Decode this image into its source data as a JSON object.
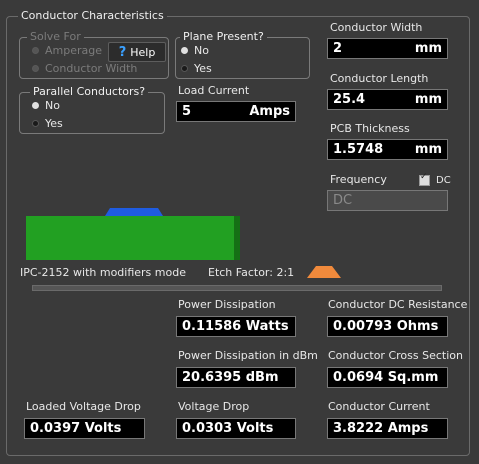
{
  "panel": {
    "title": "Conductor Characteristics"
  },
  "solve_for": {
    "title": "Solve For",
    "options": [
      "Amperage",
      "Conductor Width"
    ],
    "help_label": "Help"
  },
  "plane_present": {
    "title": "Plane Present?",
    "options": [
      "No",
      "Yes"
    ]
  },
  "parallel": {
    "title": "Parallel Conductors?",
    "options": [
      "No",
      "Yes"
    ]
  },
  "load_current": {
    "label": "Load Current",
    "value": "5",
    "unit": "Amps"
  },
  "conductor_width": {
    "label": "Conductor Width",
    "value": "2",
    "unit": "mm"
  },
  "conductor_length": {
    "label": "Conductor Length",
    "value": "25.4",
    "unit": "mm"
  },
  "pcb_thickness": {
    "label": "PCB Thickness",
    "value": "1.5748",
    "unit": "mm"
  },
  "frequency": {
    "label": "Frequency",
    "dc_label": "DC",
    "value": "DC"
  },
  "mode_text": "IPC-2152 with modifiers mode",
  "etch_factor": "Etch Factor: 2:1",
  "results": {
    "power_dissipation": {
      "label": "Power Dissipation",
      "value": "0.11586 Watts"
    },
    "dc_resistance": {
      "label": "Conductor DC Resistance",
      "value": "0.00793 Ohms"
    },
    "power_dbm": {
      "label": "Power Dissipation in dBm",
      "value": "20.6395 dBm"
    },
    "cross_section": {
      "label": "Conductor Cross Section",
      "value": "0.0694 Sq.mm"
    },
    "loaded_voltage_drop": {
      "label": "Loaded Voltage Drop",
      "value": "0.0397 Volts"
    },
    "voltage_drop": {
      "label": "Voltage Drop",
      "value": "0.0303 Volts"
    },
    "conductor_current": {
      "label": "Conductor Current",
      "value": "3.8222 Amps"
    }
  },
  "colors": {
    "board": "#22a022",
    "conductor": "#1f5ce0",
    "etch": "#f08a3c"
  }
}
